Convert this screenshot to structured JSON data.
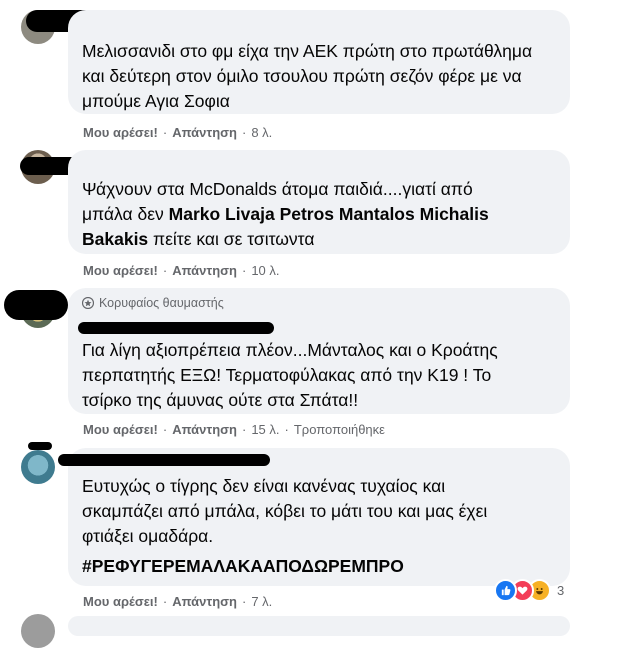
{
  "comments": [
    {
      "text": "Μελισσανιδι στο φμ είχα την ΑΕΚ πρώτη στο πρωτάθλημα και δεύτερη στον όμιλο τσουλου πρώτη σεζόν φέρε με να μπούμε Αγια Σοφια",
      "like": "Μου αρέσει!",
      "reply": "Απάντηση",
      "time": "8 λ."
    },
    {
      "text_parts": [
        "Ψάχνουν στα McDonalds άτομα παιδιά....γιατί από μπάλα δεν ",
        "Marko Livaja",
        " ",
        "Petros Mantalos",
        " ",
        "Michalis Bakakis",
        " πείτε και σε τσιτωντα"
      ],
      "like": "Μου αρέσει!",
      "reply": "Απάντηση",
      "time": "10 λ."
    },
    {
      "badge": "Κορυφαίος θαυμαστής",
      "text": "Για λίγη αξιοπρέπεια πλέον...Μάνταλος και ο Κροάτης περπατητής ΕΞΩ! Τερματοφύλακας από την Κ19 ! Το τσίρκο της άμυνας ούτε στα Σπάτα!!",
      "like": "Μου αρέσει!",
      "reply": "Απάντηση",
      "time": "15 λ.",
      "edited": "Τροποποιήθηκε"
    },
    {
      "text": "Ευτυχώς ο τίγρης δεν είναι κανένας τυχαίος και σκαμπάζει από μπάλα, κόβει το μάτι του και μας έχει φτιάξει ομαδάρα.",
      "hashtag": "#ΡΕΦΥΓΕΡΕΜΑΛΑΚΑΑΠΟΔΩΡΕΜΠΡΟ",
      "reactions_count": "3",
      "reaction_icons": [
        "like-icon",
        "love-icon",
        "haha-icon"
      ],
      "like": "Μου αρέσει!",
      "reply": "Απάντηση",
      "time": "7 λ."
    }
  ],
  "separator": "·"
}
